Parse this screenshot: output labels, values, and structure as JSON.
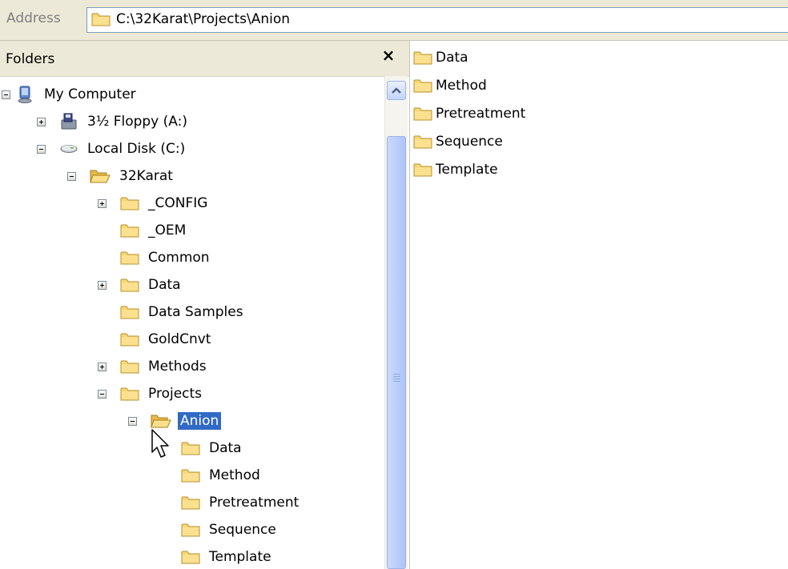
{
  "address_bar": {
    "label": "Address",
    "path": "C:\\32Karat\\Projects\\Anion",
    "icon": "folder-icon"
  },
  "folders_pane": {
    "title": "Folders",
    "close_label": "×",
    "tree": [
      {
        "label": "My Computer",
        "icon": "computer-icon",
        "expander": "minus"
      },
      {
        "label": "3½ Floppy (A:)",
        "icon": "floppy-icon",
        "expander": "plus"
      },
      {
        "label": "Local Disk (C:)",
        "icon": "drive-icon",
        "expander": "minus"
      },
      {
        "label": "32Karat",
        "icon": "open-folder-icon",
        "expander": "minus"
      },
      {
        "label": "_CONFIG",
        "icon": "folder-icon",
        "expander": "plus"
      },
      {
        "label": "_OEM",
        "icon": "folder-icon",
        "expander": "none"
      },
      {
        "label": "Common",
        "icon": "folder-icon",
        "expander": "none"
      },
      {
        "label": "Data",
        "icon": "folder-icon",
        "expander": "plus"
      },
      {
        "label": "Data Samples",
        "icon": "folder-icon",
        "expander": "none"
      },
      {
        "label": "GoldCnvt",
        "icon": "folder-icon",
        "expander": "none"
      },
      {
        "label": "Methods",
        "icon": "folder-icon",
        "expander": "plus"
      },
      {
        "label": "Projects",
        "icon": "folder-icon",
        "expander": "minus"
      },
      {
        "label": "Anion",
        "icon": "open-folder-icon",
        "expander": "minus",
        "selected": true
      },
      {
        "label": "Data",
        "icon": "folder-icon",
        "expander": "none"
      },
      {
        "label": "Method",
        "icon": "folder-icon",
        "expander": "none"
      },
      {
        "label": "Pretreatment",
        "icon": "folder-icon",
        "expander": "none"
      },
      {
        "label": "Sequence",
        "icon": "folder-icon",
        "expander": "none"
      },
      {
        "label": "Template",
        "icon": "folder-icon",
        "expander": "none"
      }
    ]
  },
  "contents_pane": {
    "items": [
      {
        "label": "Data",
        "icon": "folder-icon"
      },
      {
        "label": "Method",
        "icon": "folder-icon"
      },
      {
        "label": "Pretreatment",
        "icon": "folder-icon"
      },
      {
        "label": "Sequence",
        "icon": "folder-icon"
      },
      {
        "label": "Template",
        "icon": "folder-icon"
      }
    ]
  },
  "colors": {
    "selection": "#316ac5",
    "chrome": "#ece9d8",
    "folder": "#f7d674"
  }
}
